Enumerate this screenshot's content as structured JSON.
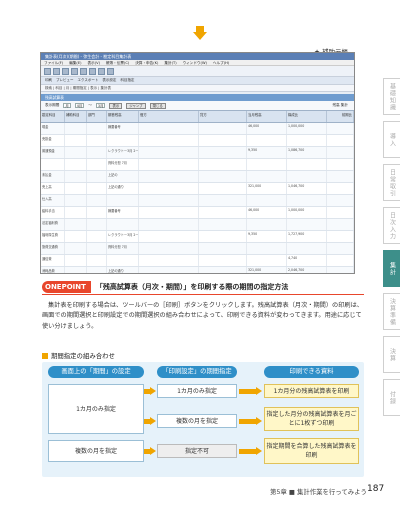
{
  "caption_top": "★ 補助元帳",
  "screenshot": {
    "window_title": "集計表(月次)(期間) - 弥生会計 - 勘定科目集計表",
    "menu": [
      "ファイル(F)",
      "編集(E)",
      "表示(V)",
      "帳簿・伝票(C)",
      "決算・申告(K)",
      "集計(T)",
      "ウィンドウ(W)",
      "ヘルプ(H)"
    ],
    "toolbar2": [
      "印刷",
      "プレビュー",
      "エクスポート",
      "表示設定",
      "科目指定"
    ],
    "toolbar3": "検索 | 科目 | 月 | 期間指定 | 表示 | 集計表",
    "section_title": "残高試算表",
    "form": {
      "period_label": "表示期間",
      "period_value": "月",
      "from_value": "4月",
      "to_label": "～",
      "to_value": "3月",
      "btn1": "表示",
      "btn2": "ジャンプ",
      "btn3": "閉じる",
      "right_label": "残高 集計"
    },
    "columns": [
      "勘定科目",
      "補助科目",
      "部門",
      "期首残高",
      "借方",
      "貸方",
      "当月残高",
      "構成比",
      "前期比"
    ],
    "rows": [
      [
        "現金",
        "",
        "",
        "摘要番号",
        "",
        "",
        "46,000",
        "1,000,000",
        ""
      ],
      [
        "売掛金",
        "",
        "",
        "",
        "",
        "",
        "",
        "",
        ""
      ],
      [
        "普通預金",
        "",
        "",
        "レクラウトー3月 2ーぼーろ",
        "",
        "",
        "9,350",
        "1,086,700",
        ""
      ],
      [
        "",
        "",
        "",
        "資料分担 7月",
        "",
        "",
        "",
        "",
        ""
      ],
      [
        "未払金",
        "",
        "",
        "上記の",
        "",
        "",
        "",
        "",
        ""
      ],
      [
        "売上高",
        "",
        "",
        "上記の通り",
        "",
        "",
        "321,000",
        "1,046,700",
        ""
      ],
      [
        "仕入高",
        "",
        "",
        "",
        "",
        "",
        "",
        "",
        ""
      ],
      [
        "給料手当",
        "",
        "",
        "摘要番号",
        "",
        "",
        "46,000",
        "1,000,000",
        ""
      ],
      [
        "法定福利費",
        "",
        "",
        "",
        "",
        "",
        "",
        "",
        ""
      ],
      [
        "福利厚生費",
        "",
        "",
        "レクラウトー3月 2ーぼーろ",
        "",
        "",
        "9,350",
        "1,727,900",
        ""
      ],
      [
        "旅費交通費",
        "",
        "",
        "資料分担 7月",
        "",
        "",
        "",
        "",
        ""
      ],
      [
        "通信費",
        "",
        "",
        "",
        "",
        "",
        "",
        "4,740",
        ""
      ],
      [
        "消耗品費",
        "",
        "",
        "上記の通り",
        "",
        "",
        "321,000",
        "2,046,700",
        ""
      ],
      [
        "水道光熱費",
        "",
        "",
        "",
        "",
        "",
        "",
        "",
        ""
      ],
      [
        "支払手数料",
        "",
        "",
        "資料分担 2月",
        "",
        "",
        "1,000,000",
        "950,700",
        ""
      ],
      [
        "地代家賃",
        "",
        "",
        "摘要番号",
        "",
        "",
        "46,000",
        "812,700",
        ""
      ],
      [
        "雑費",
        "",
        "",
        "レクラウトー3月 2ーぼーろ",
        "",
        "",
        "9,350",
        "909,800",
        ""
      ]
    ]
  },
  "side_tabs": [
    "基礎知識",
    "導入",
    "日常取引",
    "日次入力",
    "集計",
    "決算準備",
    "決算",
    "付録"
  ],
  "active_side_tab": 4,
  "onepoint": {
    "badge": "ONEPOINT",
    "title": "「残高試算表（月次・期間）」を印刷する際の期間の指定方法"
  },
  "body_text": "集計表を印刷する場合は、ツールバーの［印刷］ボタンをクリックします。残高試算表（月次・期間）の印刷は、画面での期間選択と印刷設定での期間選択の組み合わせによって、印刷できる資料が変わってきます。用途に応じて使い分けましょう。",
  "subhead": "期間指定の組み合わせ",
  "diagram": {
    "headers": [
      "画面上の「期間」の設定",
      "「印刷設定」の期間指定",
      "印刷できる資料"
    ],
    "screen_boxes": [
      "1カ月のみ指定",
      "複数の月を指定"
    ],
    "print_boxes": [
      "1カ月のみ指定",
      "複数の月を指定",
      "指定不可"
    ],
    "result_boxes": [
      "1カ月分の残高試算表を印刷",
      "指定した月分の残高試算表を月ごとに1枚ずつ印刷",
      "指定期間を合算した残高試算表を印刷"
    ]
  },
  "footer": "第5章 ■ 集計作業を行ってみよう",
  "page_number": "187",
  "colors": {
    "accent_orange": "#f0a500",
    "onepoint_red": "#e8462c",
    "header_blue": "#2f8fc8",
    "side_tab_active": "#3d8f8a"
  }
}
